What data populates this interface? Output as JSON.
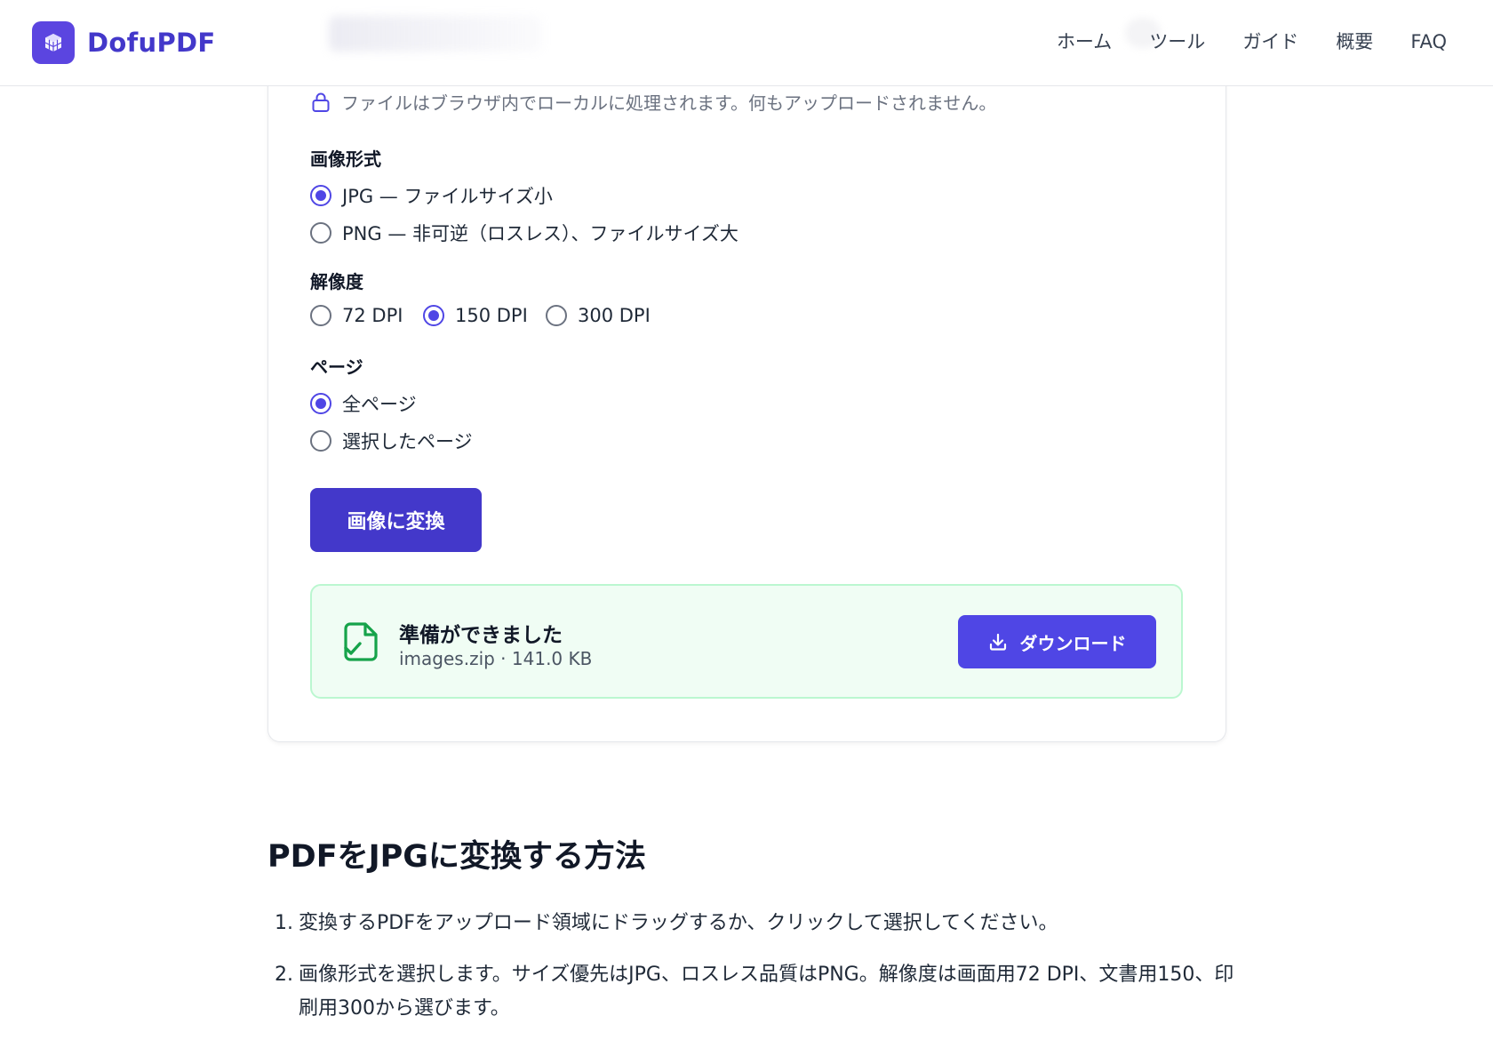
{
  "header": {
    "logo_text": "DofuPDF",
    "nav": [
      "ホーム",
      "ツール",
      "ガイド",
      "概要",
      "FAQ"
    ]
  },
  "options": {
    "local_note": "ファイルはブラウザ内でローカルに処理されます。何もアップロードされません。",
    "format": {
      "label": "画像形式",
      "choices": [
        "JPG — ファイルサイズ小",
        "PNG — 非可逆（ロスレス）、ファイルサイズ大"
      ],
      "selected": 0
    },
    "resolution": {
      "label": "解像度",
      "choices": [
        "72 DPI",
        "150 DPI",
        "300 DPI"
      ],
      "selected": 1
    },
    "pages": {
      "label": "ページ",
      "choices": [
        "全ページ",
        "選択したページ"
      ],
      "selected": 0
    },
    "convert_button": "画像に変換"
  },
  "result": {
    "title": "準備ができました",
    "file": "images.zip · 141.0 KB",
    "download_button": "ダウンロード"
  },
  "howto": {
    "title": "PDFをJPGに変換する方法",
    "steps": [
      {
        "num": "1.",
        "text": "変換するPDFをアップロード領域にドラッグするか、クリックして選択してください。"
      },
      {
        "num": "2.",
        "text": "画像形式を選択します。サイズ優先はJPG、ロスレス品質はPNG。解像度は画面用72 DPI、文書用150、印刷用300から選びます。"
      }
    ]
  },
  "colors": {
    "brand": "#4338ca",
    "accent": "#4f46e5",
    "success_bg": "#f0fdf4",
    "success_icon": "#16a34a"
  },
  "icons": [
    "cube-logo-icon",
    "lock-icon",
    "file-check-icon",
    "download-icon"
  ]
}
